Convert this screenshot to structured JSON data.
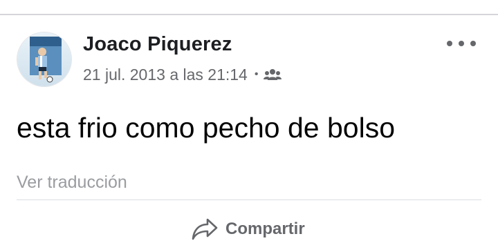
{
  "post": {
    "author_name": "Joaco Piquerez",
    "timestamp": "21 jul. 2013 a las 21:14",
    "separator": "•",
    "audience_icon": "group-icon",
    "more_icon": "more-dots-icon",
    "text": "esta frio como pecho de bolso",
    "translate_label": "Ver traducción"
  },
  "actions": {
    "share_label": "Compartir",
    "share_icon": "share-arrow-icon"
  },
  "colors": {
    "text_primary": "#1c1e21",
    "text_secondary": "#65676b",
    "translate_link": "#9a9ca0",
    "divider": "#dadde1"
  }
}
